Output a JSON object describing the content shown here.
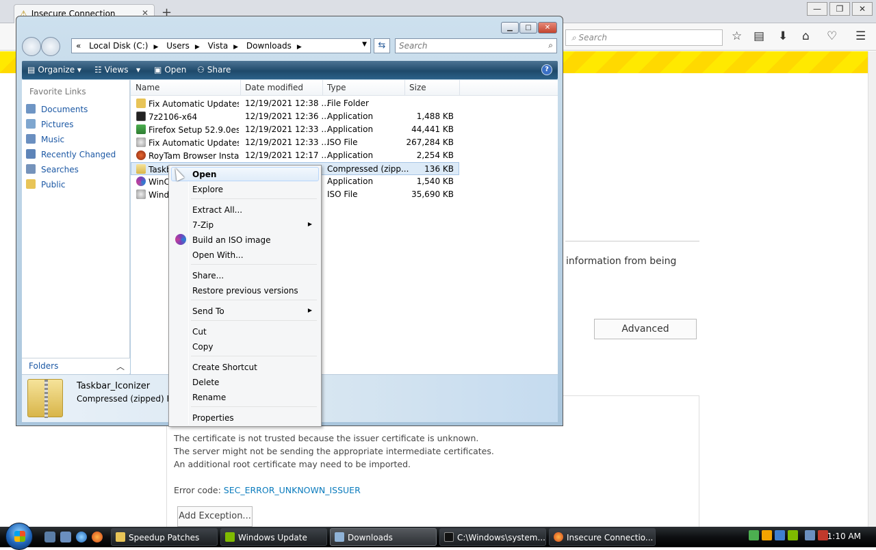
{
  "firefox": {
    "tab_title": "Insecure Connection",
    "search_placeholder": "Search",
    "partial_text": "information from being",
    "advanced_label": "Advanced",
    "details": {
      "line1": "The certificate is not trusted because the issuer certificate is unknown.",
      "line2": "The server might not be sending the appropriate intermediate certificates.",
      "line3": "An additional root certificate may need to be imported.",
      "error_prefix": "Error code: ",
      "error_code": "SEC_ERROR_UNKNOWN_ISSUER",
      "add_exception": "Add Exception..."
    }
  },
  "explorer": {
    "address": {
      "chevron": "«",
      "crumbs": [
        "Local Disk (C:)",
        "Users",
        "Vista",
        "Downloads"
      ]
    },
    "search_placeholder": "Search",
    "toolbar": {
      "organize": "Organize",
      "views": "Views",
      "open": "Open",
      "share": "Share",
      "help": "?"
    },
    "nav": {
      "heading": "Favorite Links",
      "items": [
        "Documents",
        "Pictures",
        "Music",
        "Recently Changed",
        "Searches",
        "Public"
      ],
      "folders_label": "Folders"
    },
    "columns": [
      "Name",
      "Date modified",
      "Type",
      "Size"
    ],
    "files": [
      {
        "name": "Fix Automatic Updates...",
        "date": "12/19/2021 12:38 ...",
        "type": "File Folder",
        "size": "",
        "icon": "folder-icon"
      },
      {
        "name": "7z2106-x64",
        "date": "12/19/2021 12:36 ...",
        "type": "Application",
        "size": "1,488 KB",
        "icon": "7zip-icon"
      },
      {
        "name": "Firefox Setup 52.9.0esr",
        "date": "12/19/2021 12:33 ...",
        "type": "Application",
        "size": "44,441 KB",
        "icon": "installer-icon"
      },
      {
        "name": "Fix Automatic Updates...",
        "date": "12/19/2021 12:33 ...",
        "type": "ISO File",
        "size": "267,284 KB",
        "icon": "iso-icon"
      },
      {
        "name": "RoyTam Browser Instal...",
        "date": "12/19/2021 12:17 ...",
        "type": "Application",
        "size": "2,254 KB",
        "icon": "browser-icon"
      },
      {
        "name": "Taskb",
        "date": "",
        "type": "Compressed (zipp...",
        "size": "136 KB",
        "icon": "zip-icon"
      },
      {
        "name": "WinC",
        "date": "",
        "type": "Application",
        "size": "1,540 KB",
        "icon": "app-icon"
      },
      {
        "name": "Wind",
        "date": "",
        "type": "ISO File",
        "size": "35,690 KB",
        "icon": "iso-icon"
      }
    ],
    "details_pane": {
      "name": "Taskbar_Iconizer",
      "type": "Compressed (zipped) Fold"
    }
  },
  "context_menu": {
    "items": [
      "Open",
      "Explore",
      "Extract All...",
      "7-Zip",
      "Build an ISO image",
      "Open With...",
      "Share...",
      "Restore previous versions",
      "Send To",
      "Cut",
      "Copy",
      "Create Shortcut",
      "Delete",
      "Rename",
      "Properties"
    ]
  },
  "taskbar": {
    "buttons": [
      "Speedup Patches",
      "Windows Update",
      "Downloads",
      "C:\\Windows\\system...",
      "Insecure Connectio..."
    ],
    "clock": "1:10 AM"
  },
  "colors": {
    "link_blue": "#1c58a4",
    "hazard_yellow": "#ffe900",
    "toolbar_blue": "#1f4a6b"
  }
}
